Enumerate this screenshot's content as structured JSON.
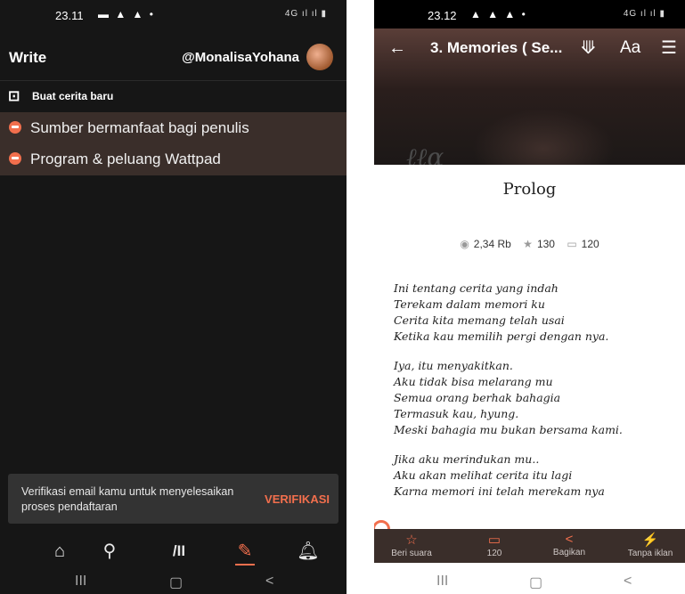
{
  "left_screen": {
    "status_bar": {
      "time": "23.11",
      "icons": "▬ ▲ ▲ •",
      "signal": "4G ıl ıl ▮"
    },
    "header": {
      "title": "Write",
      "username": "@MonalisaYohana"
    },
    "new_story": {
      "label": "Buat cerita baru"
    },
    "menu_items": [
      {
        "label": "Sumber bermanfaat bagi penulis"
      },
      {
        "label": "Program & peluang Wattpad"
      }
    ],
    "snackbar": {
      "message": "Verifikasi email kamu untuk menyelesaikan proses pendaftaran",
      "action": "VERIFIKASI"
    },
    "bottom_nav": {
      "home_icon": "⌂",
      "search_icon": "🔍",
      "library_icon": "/II",
      "write_icon": "✎",
      "notifications_icon": "🔔"
    },
    "system_nav": {
      "recent": "III",
      "home": "▢",
      "back": "<"
    }
  },
  "right_screen": {
    "status_bar": {
      "time": "23.12",
      "icons": "▲ ▲ ▲ •",
      "signal": "4G ıl ıl ▮"
    },
    "header": {
      "back_icon": "←",
      "chapter_title": "3. Memories ( Se...",
      "download_icon": "⇩",
      "font_button": "Aa",
      "toc_icon": "☰"
    },
    "chapter_heading": "Prolog",
    "stats": {
      "reads": "2,34 Rb",
      "votes": "130",
      "comments": "120"
    },
    "poem_stanzas": [
      [
        "Ini tentang cerita yang indah",
        "Terekam dalam memori ku",
        "Cerita kita memang telah usai",
        "Ketika kau memilih pergi dengan nya."
      ],
      [
        "Iya, itu menyakitkan.",
        "Aku tidak bisa melarang mu",
        "Semua orang berhak bahagia",
        "Termasuk kau, hyung.",
        "Meski bahagia mu bukan bersama kami."
      ],
      [
        "Jika aku merindukan mu..",
        "Aku akan melihat cerita itu lagi",
        "Karna memori ini telah merekam nya"
      ]
    ],
    "reading_bar": [
      {
        "label": "Beri suara",
        "icon": "☆",
        "color": "#f26f4d"
      },
      {
        "label": "120",
        "icon": "▭",
        "color": "#f26f4d"
      },
      {
        "label": "Bagikan",
        "icon": "<",
        "color": "#f26f4d"
      },
      {
        "label": "Tanpa iklan",
        "icon": "⚡",
        "color": "#b98cf0"
      }
    ],
    "system_nav": {
      "recent": "III",
      "home": "▢",
      "back": "<"
    }
  }
}
